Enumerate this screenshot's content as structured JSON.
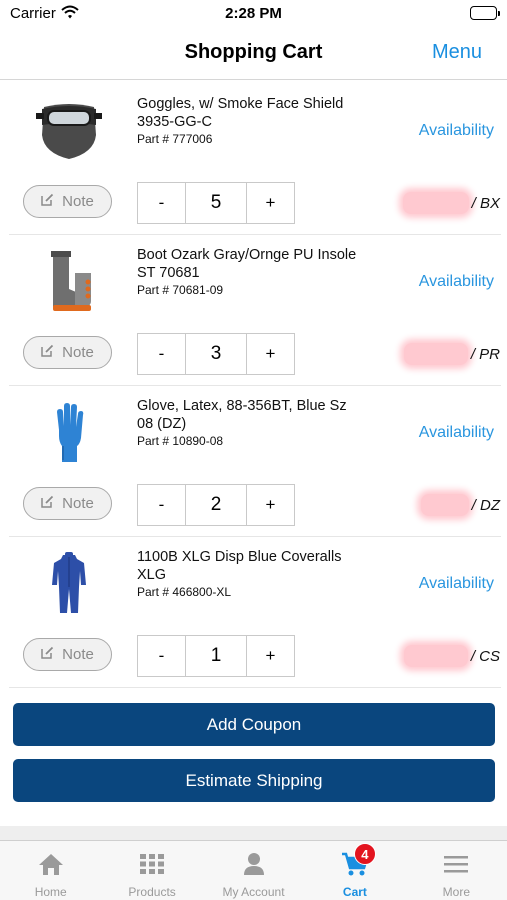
{
  "status_bar": {
    "carrier": "Carrier",
    "time": "2:28 PM"
  },
  "nav": {
    "title": "Shopping Cart",
    "menu_label": "Menu"
  },
  "items": [
    {
      "name": "Goggles, w/ Smoke Face Shield 3935-GG-C",
      "part": "Part # 777006",
      "availability": "Availability",
      "note": "Note",
      "minus": "-",
      "plus": "+",
      "qty": "5",
      "unit": "/ BX",
      "icon": "goggles-icon"
    },
    {
      "name": "Boot Ozark Gray/Ornge PU Insole ST 70681",
      "part": "Part # 70681-09",
      "availability": "Availability",
      "note": "Note",
      "minus": "-",
      "plus": "+",
      "qty": "3",
      "unit": "/ PR",
      "icon": "boot-icon"
    },
    {
      "name": "Glove, Latex, 88-356BT, Blue Sz 08 (DZ)",
      "part": "Part # 10890-08",
      "availability": "Availability",
      "note": "Note",
      "minus": "-",
      "plus": "+",
      "qty": "2",
      "unit": "/ DZ",
      "icon": "glove-icon"
    },
    {
      "name": "1100B XLG Disp Blue Coveralls XLG",
      "part": "Part # 466800-XL",
      "availability": "Availability",
      "note": "Note",
      "minus": "-",
      "plus": "+",
      "qty": "1",
      "unit": "/ CS",
      "icon": "coveralls-icon"
    }
  ],
  "actions": {
    "add_coupon": "Add Coupon",
    "estimate_shipping": "Estimate Shipping"
  },
  "tabs": [
    {
      "label": "Home",
      "icon": "home-icon"
    },
    {
      "label": "Products",
      "icon": "grid-icon"
    },
    {
      "label": "My Account",
      "icon": "person-icon"
    },
    {
      "label": "Cart",
      "icon": "cart-icon",
      "badge": "4",
      "active": true
    },
    {
      "label": "More",
      "icon": "hamburger-icon"
    }
  ],
  "colors": {
    "accent": "#1a8fe0",
    "button_bg": "#0a467e",
    "badge": "#e3141f",
    "price_blur": "#ffc9d0"
  }
}
